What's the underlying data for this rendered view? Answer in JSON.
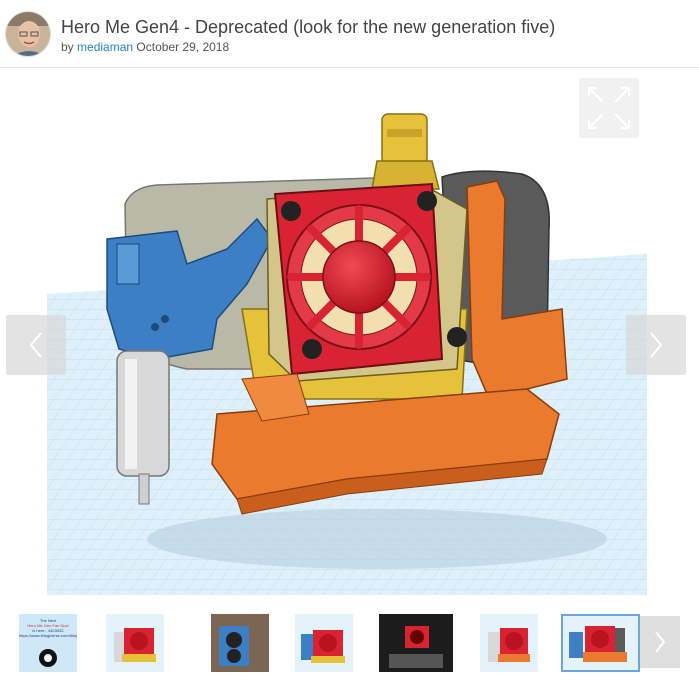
{
  "header": {
    "title": "Hero Me Gen4 - Deprecated (look for the new generation five)",
    "by_prefix": "by",
    "author": "mediaman",
    "date": "October 29, 2018"
  },
  "viewer": {
    "fullscreen_icon": "expand-icon",
    "prev_icon": "chevron-left-icon",
    "next_icon": "chevron-right-icon"
  },
  "thumbnails": {
    "count": 8,
    "active_index": 6,
    "first_thumb_text": [
      "The Next",
      "Hero Me Gen Fan Duct",
      "is here - 4403932",
      "https://www.thingiverse.com/thing:4403932"
    ],
    "next_icon": "chevron-right-icon"
  },
  "colors": {
    "link": "#2b80d1",
    "grid": "#cfe8f7",
    "red_fan": "#d92232",
    "orange_duct": "#ea7a2e",
    "blue_mount": "#3c7fc4",
    "yellow_heatsink": "#e6c23a"
  }
}
